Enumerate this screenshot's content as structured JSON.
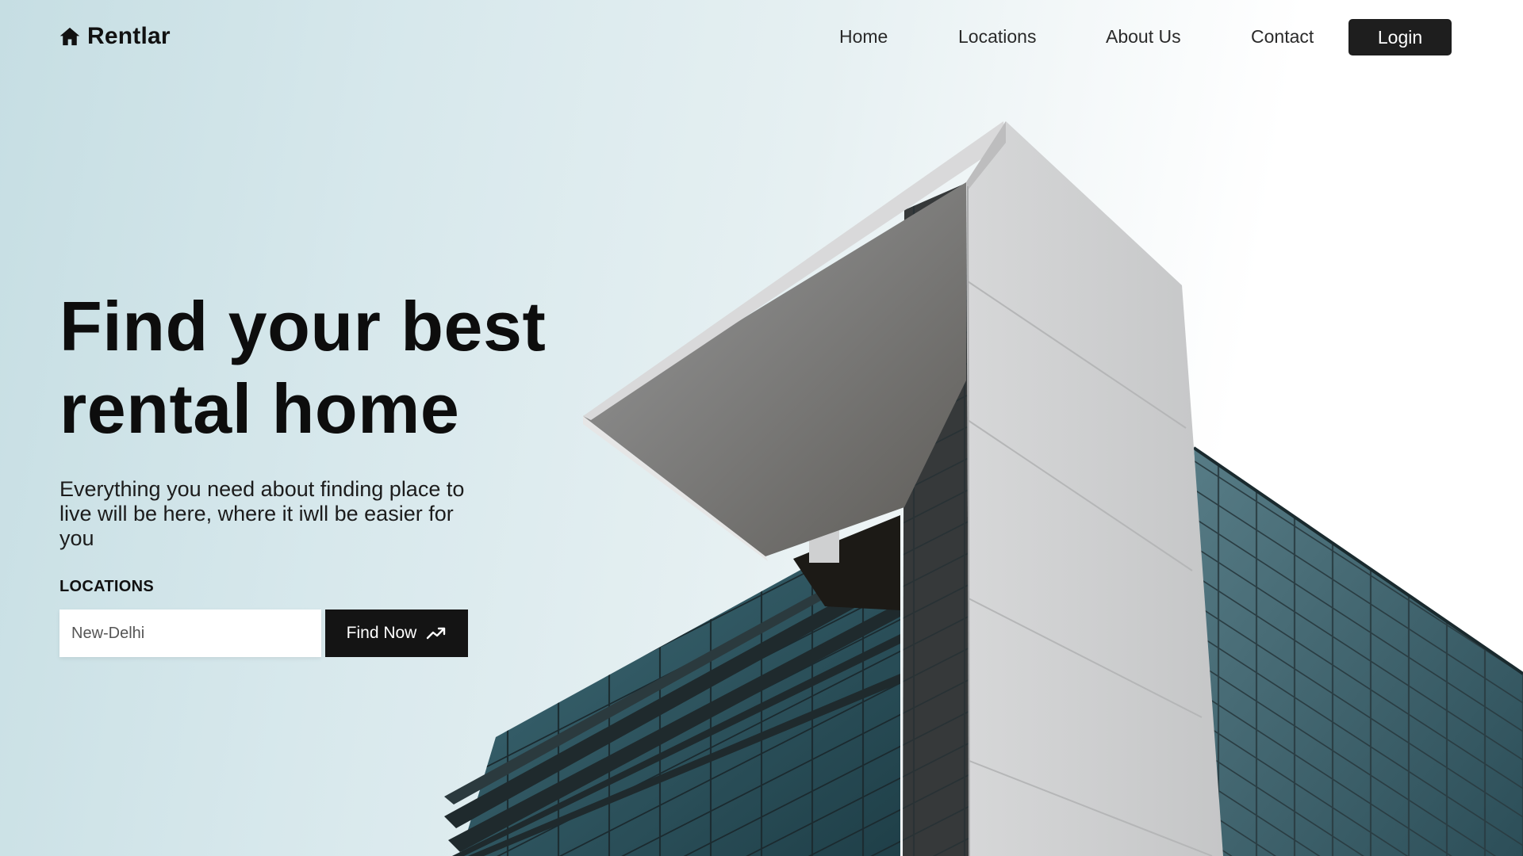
{
  "brand": {
    "name": "Rentlar",
    "icon": "home-icon"
  },
  "nav": {
    "items": [
      {
        "label": "Home"
      },
      {
        "label": "Locations"
      },
      {
        "label": "About Us"
      },
      {
        "label": "Contact"
      }
    ],
    "login_label": "Login"
  },
  "hero": {
    "title": "Find your best rental home",
    "subtitle": "Everything you need about finding place to live will be here, where it iwll be easier for you",
    "locations_label": "LOCATIONS",
    "search": {
      "placeholder": "New-Delhi",
      "value": ""
    },
    "find_button_label": "Find Now",
    "find_button_icon": "trending-up-icon"
  },
  "colors": {
    "primary_dark": "#1e1e1e",
    "background_tint": "#c6dee3",
    "text": "#111111"
  }
}
